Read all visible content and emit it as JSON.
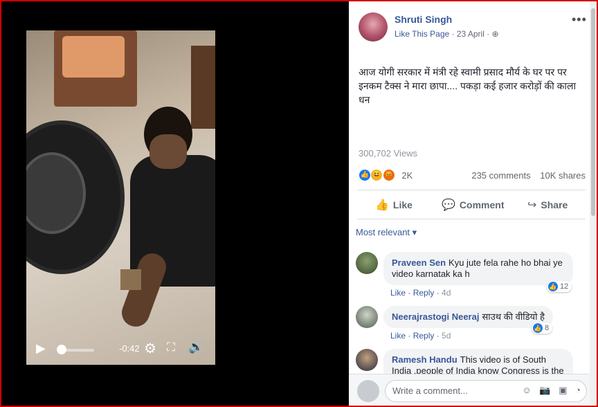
{
  "post": {
    "page_name": "Shruti Singh",
    "like_page": "Like This Page",
    "date": "· 23 April ·",
    "privacy_icon": "globe-icon",
    "text": "आज योगी सरकार में मंत्री रहे स्वामी प्रसाद मौर्य के घर पर पर इनकम टैक्स ने मारा छापा.... पकड़ा कई हजार करोड़ों की काला धन",
    "views": "300,702 Views",
    "reaction_count": "2K",
    "comments_count": "235 comments",
    "shares_count": "10K shares",
    "actions": {
      "like": "Like",
      "comment": "Comment",
      "share": "Share"
    }
  },
  "video": {
    "time_remaining": "-0:42",
    "progress": 0.05
  },
  "comments": {
    "sort_label": "Most relevant ▾",
    "items": [
      {
        "author": "Praveen Sen",
        "text": "Kyu jute fela rahe ho bhai ye video karnatak ka h",
        "like": "Like",
        "reply": "Reply",
        "time": "4d",
        "reactions": "12"
      },
      {
        "author": "Neerajrastogi Neeraj",
        "text": "साउथ की वीडियो है",
        "like": "Like",
        "reply": "Reply",
        "time": "5d",
        "reactions": "8"
      },
      {
        "author": "Ramesh Handu",
        "text": "This video is of South India .people of India know Congress is the most"
      }
    ]
  },
  "write_comment": {
    "placeholder": "Write a comment..."
  },
  "colors": {
    "link": "#385898",
    "accent_border": "#d10000"
  }
}
